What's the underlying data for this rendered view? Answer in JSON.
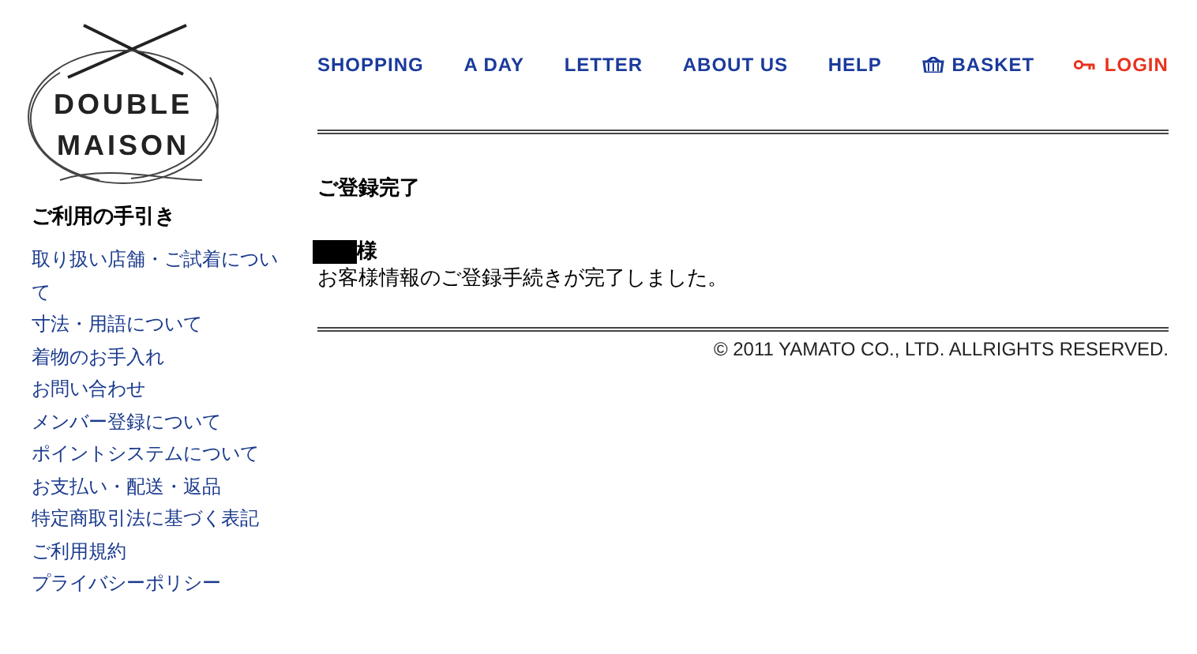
{
  "logo": {
    "line_1": "DOUBLE",
    "line_2": "MAISON"
  },
  "nav": [
    {
      "label": "SHOPPING",
      "kind": "plain"
    },
    {
      "label": "A DAY",
      "kind": "plain"
    },
    {
      "label": "LETTER",
      "kind": "plain"
    },
    {
      "label": "ABOUT US",
      "kind": "plain"
    },
    {
      "label": "HELP",
      "kind": "plain"
    },
    {
      "label": "BASKET",
      "kind": "basket"
    },
    {
      "label": "LOGIN",
      "kind": "login"
    }
  ],
  "sidebar": {
    "title": "ご利用の手引き",
    "items": [
      "取り扱い店舗・ご試着について",
      "寸法・用語について",
      "着物のお手入れ",
      "お問い合わせ",
      "メンバー登録について",
      "ポイントシステムについて",
      "お支払い・配送・返品",
      "特定商取引法に基づく表記",
      "ご利用規約",
      "プライバシーポリシー"
    ]
  },
  "main": {
    "heading": "ご登録完了",
    "honorific": "様",
    "message": "お客様情報のご登録手続きが完了しました。"
  },
  "footer": {
    "copyright": "© 2011 YAMATO CO., LTD. ALLRIGHTS RESERVED."
  }
}
